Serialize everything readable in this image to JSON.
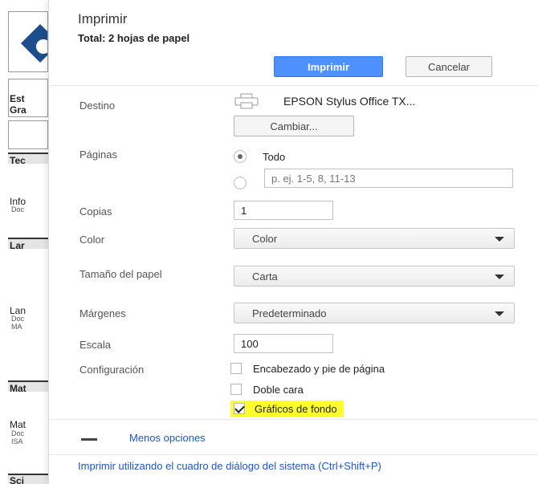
{
  "background": {
    "rows": [
      {
        "label": "Est",
        "top": true
      },
      {
        "label": "Gra"
      },
      {
        "label": "Tec"
      },
      {
        "label": "Info"
      },
      {
        "label": "Doc"
      },
      {
        "label": "Lar"
      },
      {
        "label": "Lan"
      },
      {
        "label": "Doc"
      },
      {
        "label": "MA"
      },
      {
        "label": "Mat"
      },
      {
        "label": "Mat"
      },
      {
        "label": "Doc"
      },
      {
        "label": "ISA"
      },
      {
        "label": "Sci"
      }
    ]
  },
  "dialog": {
    "title": "Imprimir",
    "total": "Total: 2 hojas de papel",
    "print_label": "Imprimir",
    "cancel_label": "Cancelar",
    "destination": {
      "label": "Destino",
      "printer": "EPSON Stylus Office TX...",
      "change_label": "Cambiar..."
    },
    "pages": {
      "label": "Páginas",
      "all_label": "Todo",
      "range_placeholder": "p. ej. 1-5, 8, 11-13"
    },
    "copies": {
      "label": "Copias",
      "value": "1"
    },
    "color": {
      "label": "Color",
      "value": "Color"
    },
    "paper_size": {
      "label": "Tamaño del papel",
      "value": "Carta"
    },
    "margins": {
      "label": "Márgenes",
      "value": "Predeterminado"
    },
    "scale": {
      "label": "Escala",
      "value": "100"
    },
    "settings": {
      "label": "Configuración",
      "headers_footers": "Encabezado y pie de página",
      "two_sided": "Doble cara",
      "background_graphics": "Gráficos de fondo"
    },
    "less_options": "Menos opciones",
    "system_dialog": "Imprimir utilizando el cuadro de diálogo del sistema (Ctrl+Shift+P)",
    "highlight_color": "#ffff2e",
    "primary_color": "#4d90fe",
    "link_color": "#1a56c9"
  }
}
